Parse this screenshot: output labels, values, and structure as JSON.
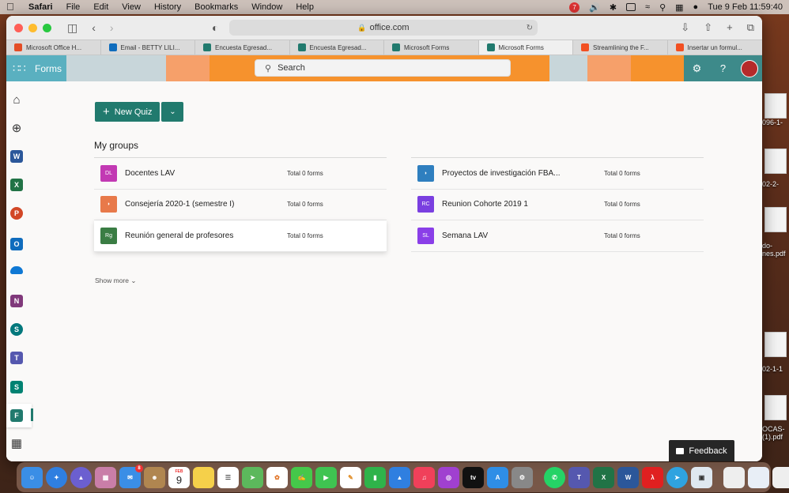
{
  "menubar": {
    "app": "Safari",
    "items": [
      "File",
      "Edit",
      "View",
      "History",
      "Bookmarks",
      "Window",
      "Help"
    ],
    "clock": "Tue 9 Feb  11:59:40",
    "notification_badge": "7"
  },
  "browser": {
    "url": "office.com",
    "tabs": [
      {
        "label": "Microsoft Office H...",
        "color": "#e44d26"
      },
      {
        "label": "Email - BETTY LILI...",
        "color": "#0f6cbd"
      },
      {
        "label": "Encuesta Egresad...",
        "color": "#217a6e"
      },
      {
        "label": "Encuesta Egresad...",
        "color": "#217a6e"
      },
      {
        "label": "Microsoft Forms",
        "color": "#217a6e"
      },
      {
        "label": "Microsoft Forms",
        "color": "#217a6e"
      },
      {
        "label": "Streamlining the F...",
        "color": "#f25022"
      },
      {
        "label": "Insertar un formul...",
        "color": "#f25022"
      }
    ],
    "active_tab": 5
  },
  "header": {
    "app_name": "Forms",
    "search_placeholder": "Search",
    "strip_colors": [
      "#c8d6da",
      "#f6a06a",
      "#f6922d",
      "#f6922d",
      "#c8d6da",
      "#f6a06a",
      "#f6922d",
      "#f6922d"
    ]
  },
  "nav_icons": [
    "home-icon",
    "create-icon",
    "word-icon",
    "excel-icon",
    "powerpoint-icon",
    "outlook-icon",
    "onedrive-icon",
    "onenote-icon",
    "sharepoint-icon",
    "teams-icon",
    "sway-icon",
    "forms-icon",
    "all-apps-icon"
  ],
  "main": {
    "new_quiz_label": "New Quiz",
    "section_title": "My groups",
    "show_more": "Show more",
    "groups_left": [
      {
        "initials": "DL",
        "name": "Docentes LAV",
        "count": "Total 0 forms",
        "color": "#c239b3"
      },
      {
        "initials": "",
        "name": "Consejería 2020-1 (semestre I)",
        "count": "Total 0 forms",
        "color": "#e8794a"
      },
      {
        "initials": "Rg",
        "name": "Reunión general de profesores",
        "count": "Total 0 forms",
        "color": "#3a7d44"
      }
    ],
    "groups_right": [
      {
        "initials": "",
        "name": "Proyectos de investigación FBA...",
        "count": "Total 0 forms",
        "color": "#2f7fbf"
      },
      {
        "initials": "RC",
        "name": "Reunion Cohorte 2019 1",
        "count": "Total 0 forms",
        "color": "#7a3fe0"
      },
      {
        "initials": "SL",
        "name": "Semana LAV",
        "count": "Total 0 forms",
        "color": "#8a3fe8"
      }
    ],
    "feedback_label": "Feedback"
  },
  "desktop_files": [
    "096-1-",
    "02-2-",
    "do-\nnes.pdf",
    "02-1-1",
    "OCAS-\n(1).pdf"
  ],
  "dock": {
    "calendar_month": "FEB",
    "calendar_day": "9",
    "mail_badge": "8"
  }
}
